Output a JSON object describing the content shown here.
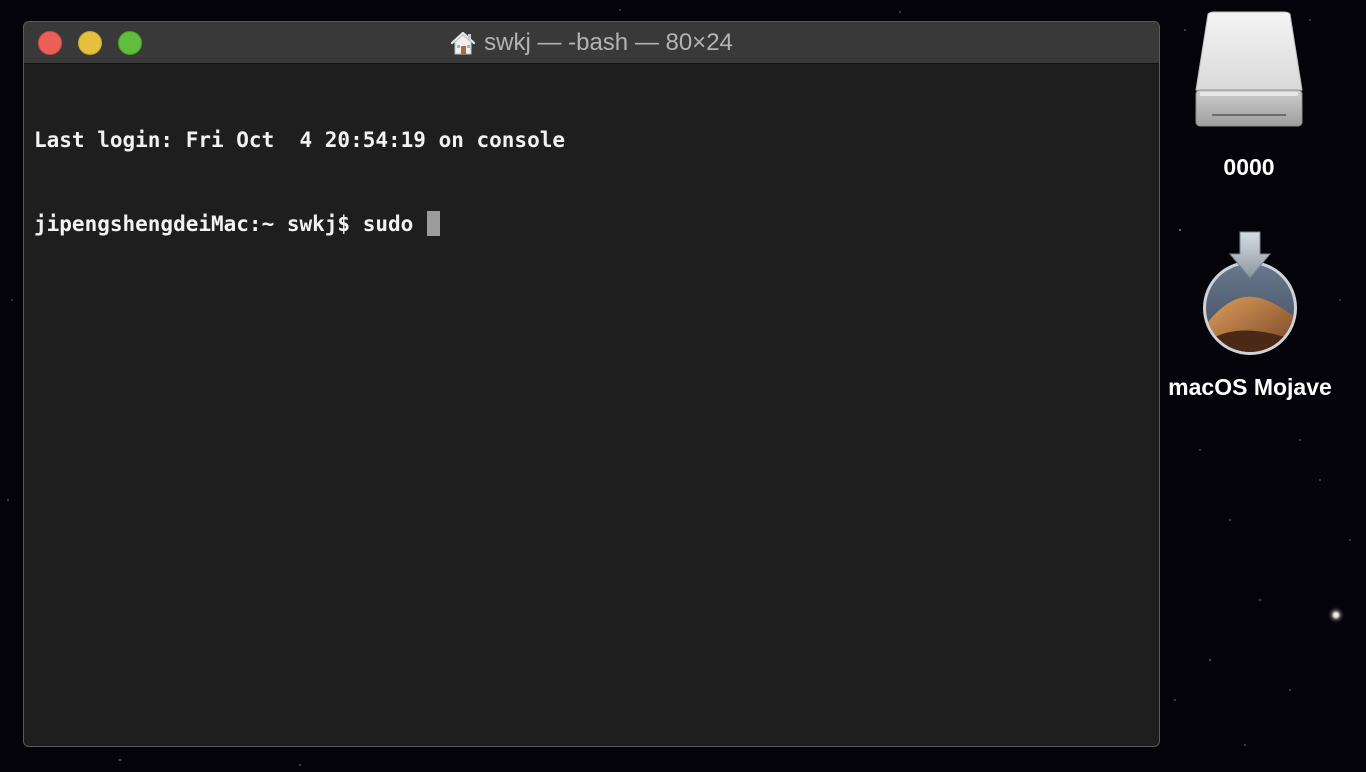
{
  "window": {
    "title": "swkj — -bash — 80×24",
    "title_icon": "home-icon",
    "traffic_lights": {
      "close": "#ec5f57",
      "minimize": "#e4c03f",
      "zoom": "#5fbe3d"
    }
  },
  "terminal": {
    "lines": [
      "Last login: Fri Oct  4 20:54:19 on console",
      "jipengshengdeiMac:~ swkj$ sudo "
    ],
    "cursor": "block"
  },
  "desktop": {
    "icons": [
      {
        "label": "0000",
        "icon": "external-drive-icon"
      },
      {
        "label": "macOS Mojave",
        "icon": "macos-installer-icon"
      }
    ]
  }
}
